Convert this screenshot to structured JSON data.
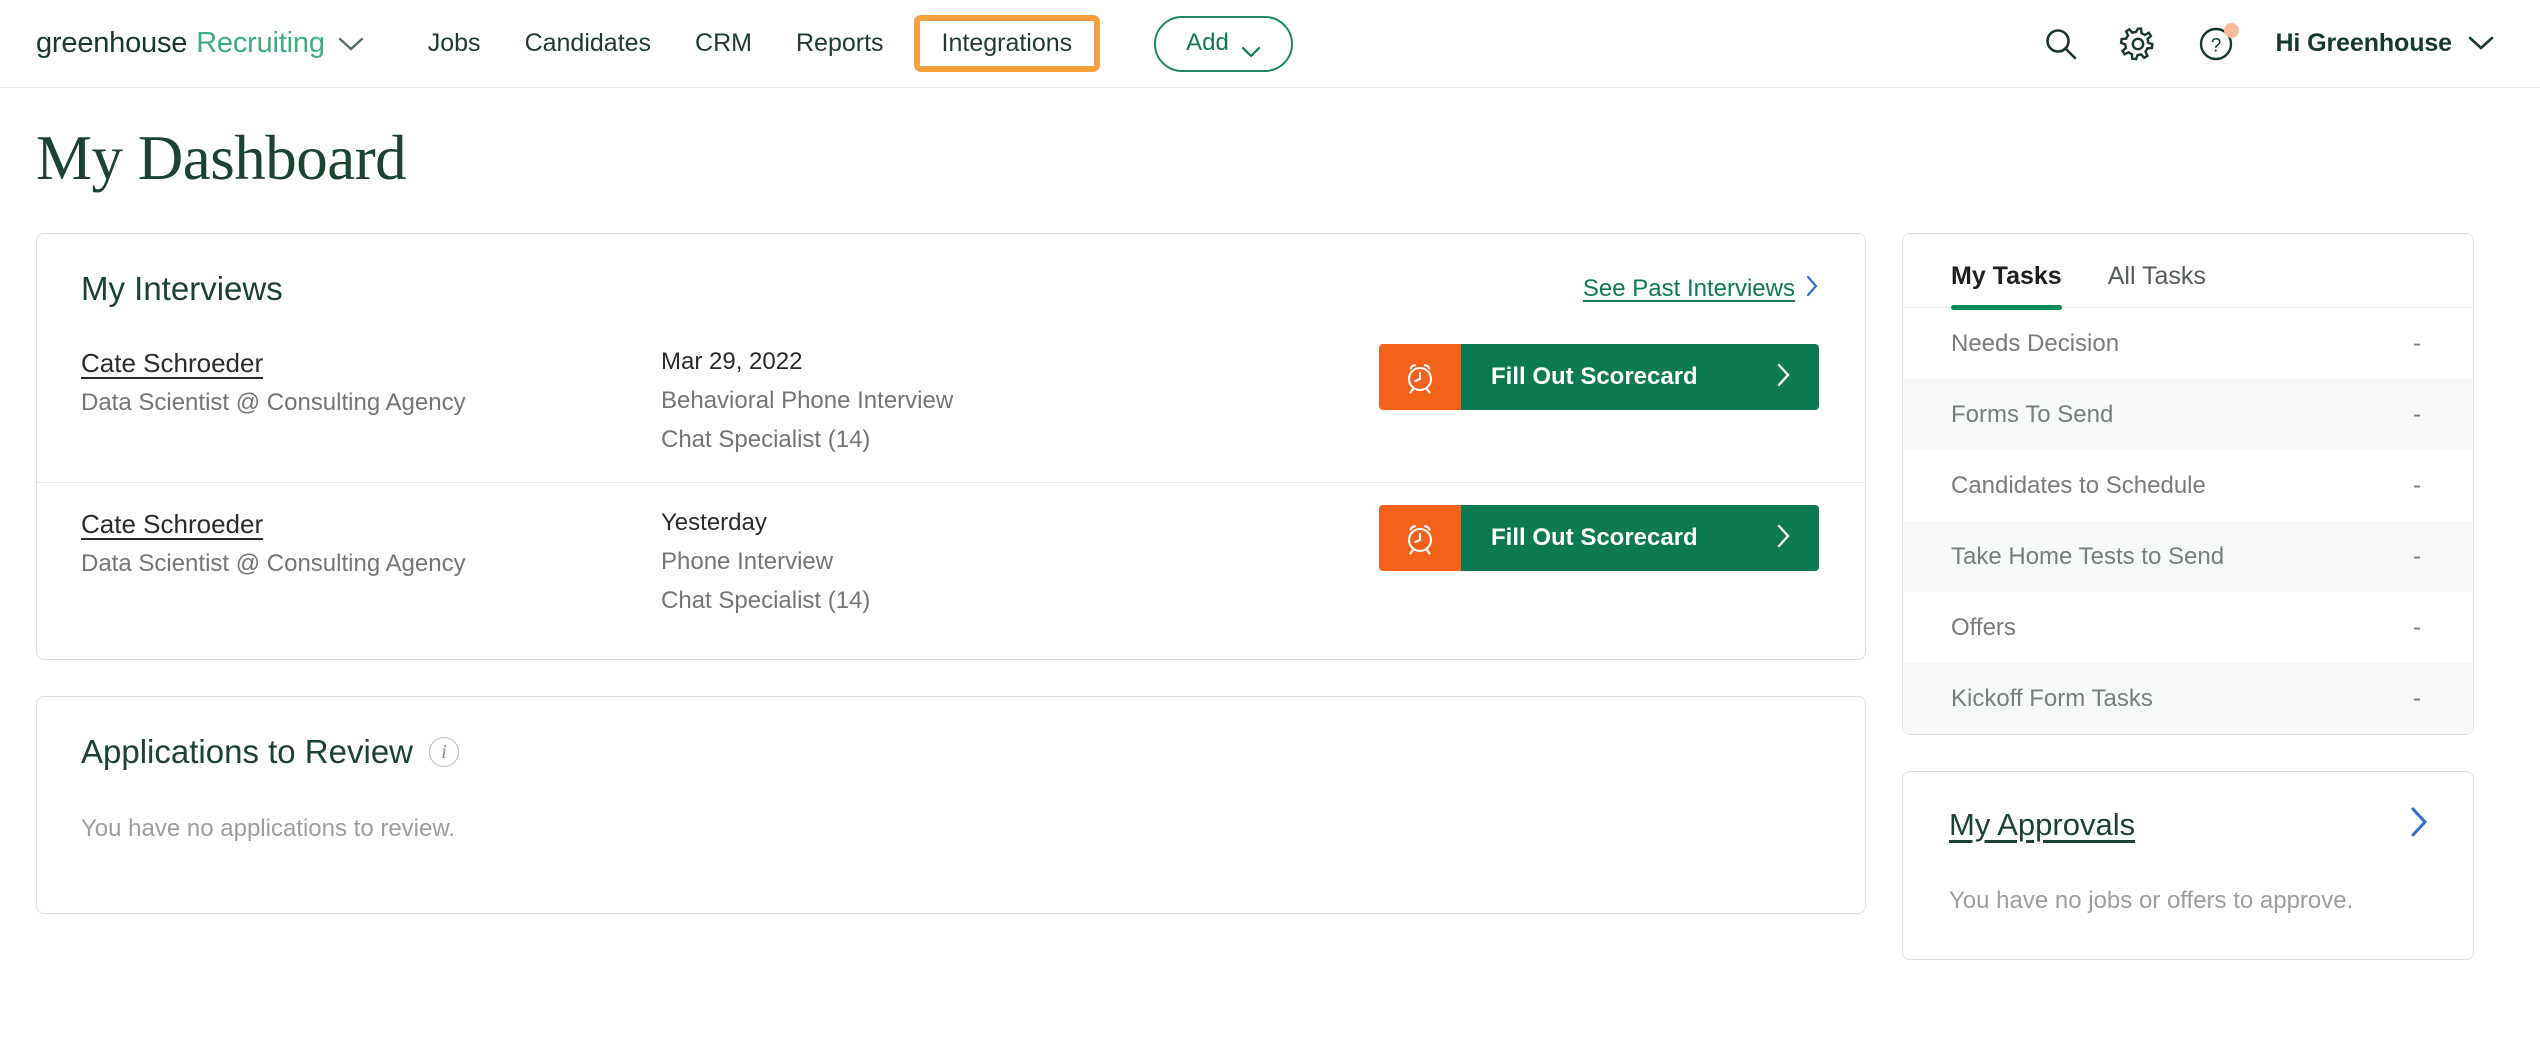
{
  "nav": {
    "brand_primary": "greenhouse",
    "brand_secondary": "Recruiting",
    "links": [
      {
        "label": "Jobs",
        "highlighted": false
      },
      {
        "label": "Candidates",
        "highlighted": false
      },
      {
        "label": "CRM",
        "highlighted": false
      },
      {
        "label": "Reports",
        "highlighted": false
      }
    ],
    "highlighted_link": "Integrations",
    "add_button": "Add",
    "greeting": "Hi Greenhouse",
    "icons": {
      "search": "search-icon",
      "settings": "gear-icon",
      "help": "help-circle-icon"
    },
    "highlight_color": "#f5a03c",
    "accent_green": "#0f7a52"
  },
  "page": {
    "title": "My Dashboard"
  },
  "interviews": {
    "title": "My Interviews",
    "see_past_label": "See Past Interviews",
    "rows": [
      {
        "candidate": "Cate Schroeder",
        "role": "Data Scientist @ Consulting Agency",
        "date": "Mar 29, 2022",
        "interview_type": "Behavioral Phone Interview",
        "stage": "Chat Specialist (14)",
        "action_label": "Fill Out Scorecard"
      },
      {
        "candidate": "Cate Schroeder",
        "role": "Data Scientist @ Consulting Agency",
        "date": "Yesterday",
        "interview_type": "Phone Interview",
        "stage": "Chat Specialist (14)",
        "action_label": "Fill Out Scorecard"
      }
    ]
  },
  "applications": {
    "title": "Applications to Review",
    "empty_text": "You have no applications to review."
  },
  "tasks": {
    "tabs": [
      {
        "label": "My Tasks",
        "active": true
      },
      {
        "label": "All Tasks",
        "active": false
      }
    ],
    "rows": [
      {
        "label": "Needs Decision",
        "count": "-"
      },
      {
        "label": "Forms To Send",
        "count": "-"
      },
      {
        "label": "Candidates to Schedule",
        "count": "-"
      },
      {
        "label": "Take Home Tests to Send",
        "count": "-"
      },
      {
        "label": "Offers",
        "count": "-"
      },
      {
        "label": "Kickoff Form Tasks",
        "count": "-"
      }
    ]
  },
  "approvals": {
    "title": "My Approvals",
    "empty_text": "You have no jobs or offers to approve."
  }
}
